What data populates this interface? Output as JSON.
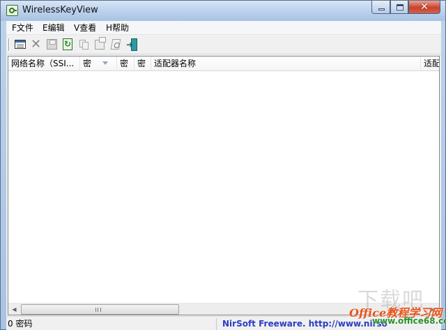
{
  "window": {
    "title": "WirelessKeyView",
    "close_glyph": "✕"
  },
  "menu": {
    "items": [
      {
        "label": "F文件"
      },
      {
        "label": "E编辑"
      },
      {
        "label": "V查看"
      },
      {
        "label": "H帮助"
      }
    ]
  },
  "toolbar": {
    "delete_glyph": "✕",
    "exit_arrow": "➜"
  },
  "table": {
    "columns": [
      {
        "label": "网络名称（SSI..."
      },
      {
        "label": "密"
      },
      {
        "label": "密"
      },
      {
        "label": "密"
      },
      {
        "label": "适配器名称"
      },
      {
        "label": "适配"
      }
    ]
  },
  "scrollbar": {
    "left_arrow": "◀",
    "right_arrow": "▶"
  },
  "status": {
    "count_text": "0 密码",
    "link_text": "NirSoft Freeware.  http://www.nirso"
  },
  "watermark": {
    "big": "下载吧",
    "line1": "Office教程学习网",
    "line2": "www.office68.com"
  }
}
